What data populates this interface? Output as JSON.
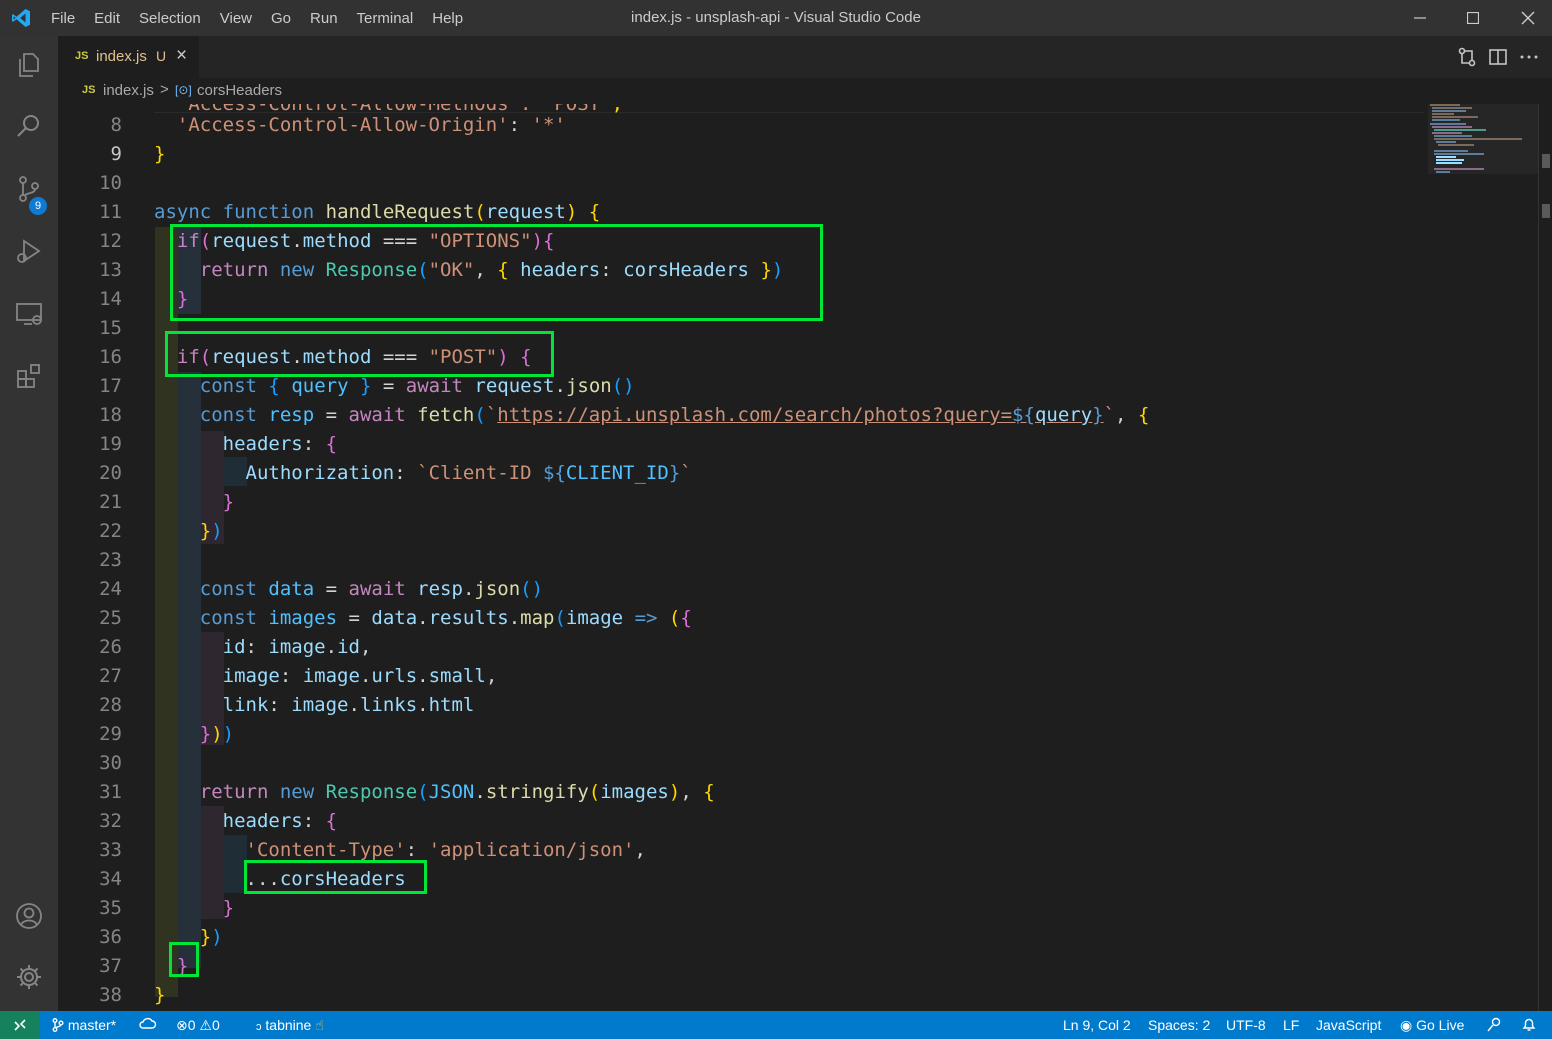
{
  "window": {
    "title": "index.js - unsplash-api - Visual Studio Code",
    "menu": [
      "File",
      "Edit",
      "Selection",
      "View",
      "Go",
      "Run",
      "Terminal",
      "Help"
    ]
  },
  "activity_bar": {
    "items": [
      "explorer-icon",
      "search-icon",
      "source-control-icon",
      "run-debug-icon",
      "remote-explorer-icon",
      "extensions-icon",
      "accounts-icon",
      "settings-gear-icon"
    ],
    "source_control_badge": "9"
  },
  "tab": {
    "icon": "JS",
    "name": "index.js",
    "status": "U"
  },
  "breadcrumb": {
    "icon": "JS",
    "file": "index.js",
    "separator": ">",
    "symbol": "corsHeaders"
  },
  "editor": {
    "current_line": 9,
    "line_numbers": [
      "8",
      "9",
      "10",
      "11",
      "12",
      "13",
      "14",
      "15",
      "16",
      "17",
      "18",
      "19",
      "20",
      "21",
      "22",
      "23",
      "24",
      "25",
      "26",
      "27",
      "28",
      "29",
      "30",
      "31",
      "32",
      "33",
      "34",
      "35",
      "36",
      "37",
      "38"
    ]
  },
  "status_bar": {
    "branch": "master*",
    "errors": "0",
    "warnings": "0",
    "tabnine": "tabnine",
    "position": "Ln 9, Col 2",
    "spaces": "Spaces: 2",
    "encoding": "UTF-8",
    "eol": "LF",
    "language": "JavaScript",
    "go_live": "Go Live"
  },
  "colors": {
    "highlight_box": "#00e636",
    "status_bar": "#007acc",
    "keyword": "#569cd6",
    "string": "#ce9178"
  }
}
